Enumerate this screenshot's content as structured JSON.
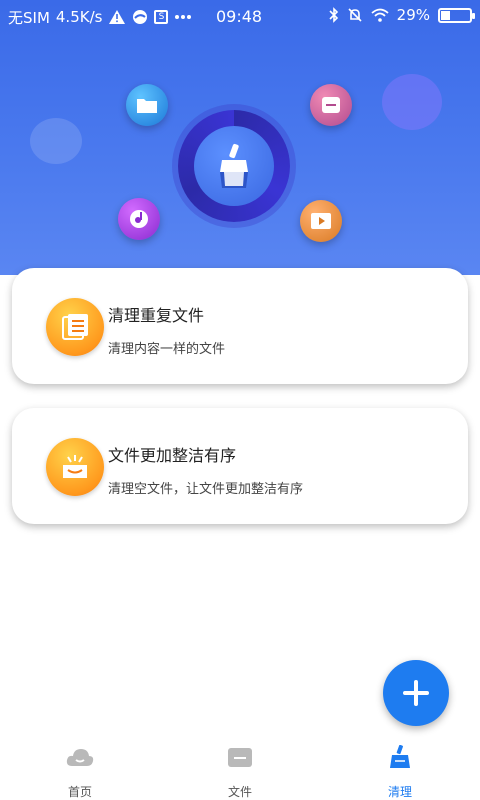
{
  "status_bar": {
    "carrier": "无SIM",
    "speed": "4.5K/s",
    "time": "09:48",
    "battery": "29%",
    "battery_level": 0.29
  },
  "hero": {
    "icons": [
      "folder-icon",
      "document-icon",
      "music-icon",
      "video-icon",
      "broom-icon"
    ]
  },
  "cards": [
    {
      "title": "清理重复文件",
      "subtitle": "清理内容一样的文件",
      "icon": "document-stack-icon"
    },
    {
      "title": "文件更加整洁有序",
      "subtitle": "清理空文件，让文件更加整洁有序",
      "icon": "tray-icon"
    }
  ],
  "fab": {
    "icon": "plus-icon"
  },
  "bottom_nav": {
    "items": [
      {
        "label": "首页",
        "icon": "cloud-icon",
        "active": false
      },
      {
        "label": "文件",
        "icon": "folder-icon",
        "active": false
      },
      {
        "label": "清理",
        "icon": "broom-icon",
        "active": true
      }
    ]
  },
  "colors": {
    "hero_blue": "#3a6ae8",
    "accent_blue": "#1e7cf0",
    "card_orange": "#ff9a1e"
  }
}
